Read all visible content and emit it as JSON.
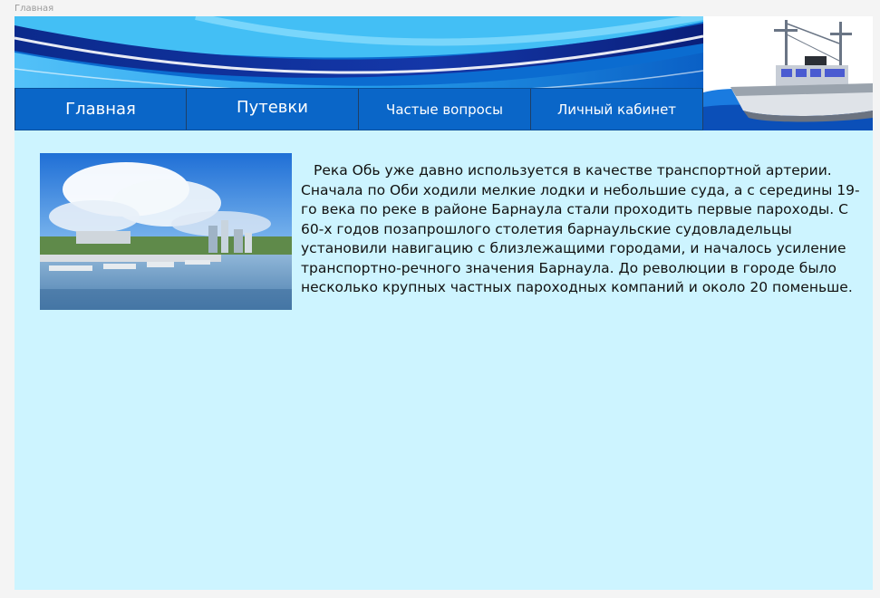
{
  "window": {
    "frame_label": "Главная"
  },
  "nav": {
    "items": [
      {
        "label": "Главная"
      },
      {
        "label": "Путевки"
      },
      {
        "label": "Частые вопросы"
      },
      {
        "label": "Личный кабинет"
      }
    ]
  },
  "main": {
    "paragraph": "Река Обь уже давно используется в качестве транспортной артерии. Сначала по Оби ходили мелкие лодки и небольшие суда, а с середины 19-го века по реке в районе Барнаула стали проходить первые пароходы. С 60-х годов позапрошлого столетия барнаульские судовладельцы установили навигацию с близлежащими городами, и началось усиление транспортно-речного значения Барнаула. До революции в городе было несколько крупных частных пароходных компаний и около 20 поменьше."
  },
  "colors": {
    "page_background": "#cdf4ff",
    "nav_background": "#0a66c8",
    "nav_text": "#ffffff"
  },
  "icons": {
    "banner": "blue-wave-banner",
    "ship": "ship-illustration",
    "photo": "river-city-photo"
  }
}
